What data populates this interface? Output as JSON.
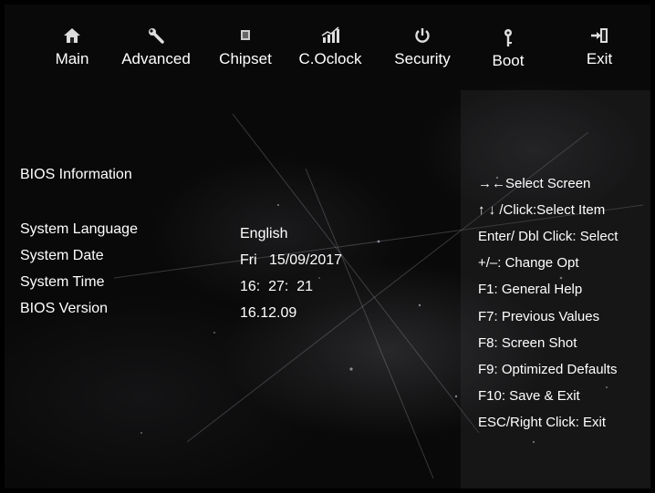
{
  "nav": {
    "items": [
      {
        "label": "Main",
        "icon": "home-icon"
      },
      {
        "label": "Advanced",
        "icon": "wrench-icon"
      },
      {
        "label": "Chipset",
        "icon": "chip-icon"
      },
      {
        "label": "C.Oclock",
        "icon": "bar-chart-icon"
      },
      {
        "label": "Security",
        "icon": "power-icon"
      },
      {
        "label": "Boot",
        "icon": "key-icon"
      },
      {
        "label": "Exit",
        "icon": "exit-icon"
      }
    ]
  },
  "main": {
    "section_title": "BIOS Information",
    "fields": [
      {
        "label": "System Language",
        "value": "English"
      },
      {
        "label": "System Date",
        "value": "Fri   15/09/2017"
      },
      {
        "label": "System Time",
        "value": "16:  27:  21"
      },
      {
        "label": "BIOS Version",
        "value": "16.12.09"
      }
    ]
  },
  "help": {
    "lines": [
      "→←Select Screen",
      "↑ ↓ /Click:Select Item",
      "Enter/ Dbl Click: Select",
      "+/–: Change Opt",
      "F1: General Help",
      "F7: Previous Values",
      "F8: Screen Shot",
      "F9: Optimized Defaults",
      "F10: Save & Exit",
      "ESC/Right Click: Exit"
    ]
  },
  "colors": {
    "text": "#ffffff",
    "background": "#090909",
    "panel": "#46464b"
  }
}
